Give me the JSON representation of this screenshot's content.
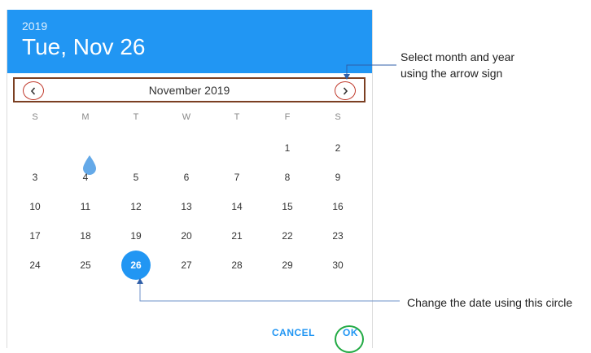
{
  "header": {
    "year": "2019",
    "date": "Tue, Nov 26"
  },
  "month_bar": {
    "label": "November 2019",
    "prev_icon": "chevron-left-icon",
    "next_icon": "chevron-right-icon"
  },
  "weekdays": [
    "S",
    "M",
    "T",
    "W",
    "T",
    "F",
    "S"
  ],
  "days": {
    "row1": [
      "",
      "",
      "",
      "",
      "",
      "1",
      "2"
    ],
    "row2": [
      "3",
      "4",
      "5",
      "6",
      "7",
      "8",
      "9"
    ],
    "row3": [
      "10",
      "11",
      "12",
      "13",
      "14",
      "15",
      "16"
    ],
    "row4": [
      "17",
      "18",
      "19",
      "20",
      "21",
      "22",
      "23"
    ],
    "row5": [
      "24",
      "25",
      "26",
      "27",
      "28",
      "29",
      "30"
    ]
  },
  "selected_day": "26",
  "actions": {
    "cancel": "CANCEL",
    "ok": "OK"
  },
  "annotations": {
    "month_year": "Select month and year\nusing the arrow sign",
    "circle": "Change the date using this circle"
  },
  "colors": {
    "accent": "#2196f3",
    "nav_highlight": "#7b3f22",
    "arrow_circle": "#c0392b",
    "ok_highlight": "#22aa44",
    "annotation_line": "#2f5fa8"
  }
}
